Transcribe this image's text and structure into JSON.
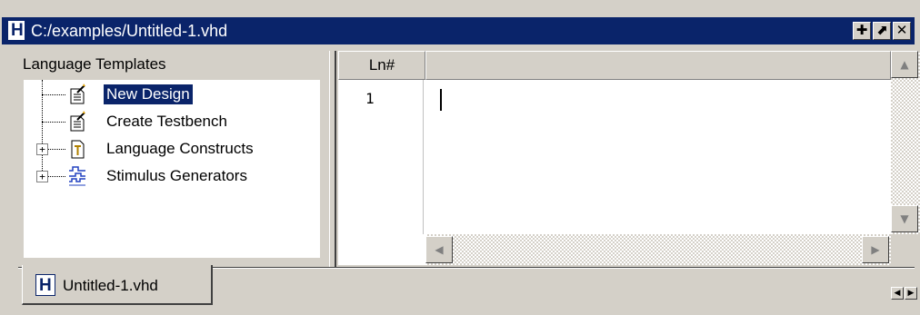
{
  "window": {
    "title": "C:/examples/Untitled-1.vhd",
    "icon": "H",
    "buttons": [
      {
        "name": "dock",
        "glyph": "✚"
      },
      {
        "name": "float",
        "glyph": "⬈"
      },
      {
        "name": "close",
        "glyph": "✕"
      }
    ]
  },
  "templates": {
    "title": "Language Templates",
    "items": [
      {
        "label": "New Design",
        "icon": "wizard-icon",
        "expandable": false,
        "selected": true
      },
      {
        "label": "Create Testbench",
        "icon": "wizard-icon",
        "expandable": false,
        "selected": false
      },
      {
        "label": "Language Constructs",
        "icon": "template-icon",
        "expandable": true,
        "selected": false
      },
      {
        "label": "Stimulus Generators",
        "icon": "waveform-icon",
        "expandable": true,
        "selected": false
      }
    ]
  },
  "editor": {
    "ln_header": "Ln#",
    "lines": [
      "1"
    ]
  },
  "tabs": [
    {
      "label": "Untitled-1.vhd",
      "icon": "H",
      "active": true
    }
  ],
  "colors": {
    "titlebar": "#0a246a",
    "selection": "#0a246a",
    "face": "#d4d0c8"
  }
}
